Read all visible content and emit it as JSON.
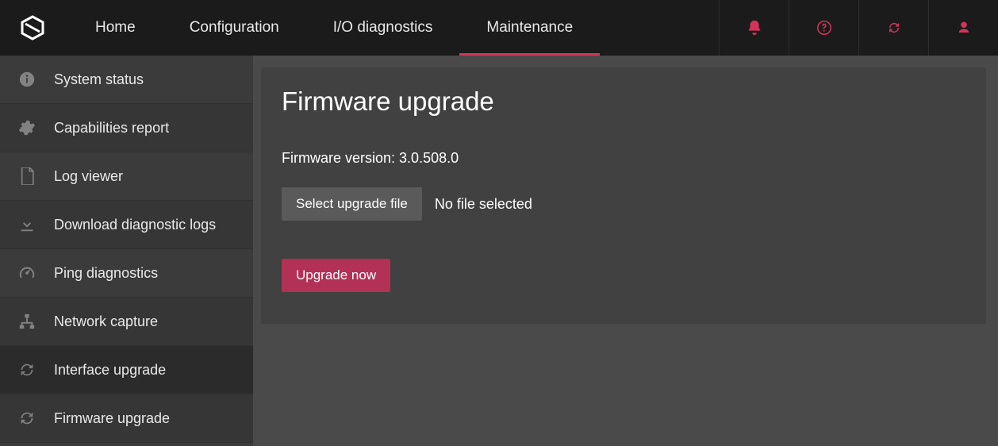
{
  "nav": {
    "items": [
      {
        "label": "Home"
      },
      {
        "label": "Configuration"
      },
      {
        "label": "I/O diagnostics"
      },
      {
        "label": "Maintenance",
        "active": true
      }
    ]
  },
  "sidebar": {
    "items": [
      {
        "label": "System status"
      },
      {
        "label": "Capabilities report"
      },
      {
        "label": "Log viewer"
      },
      {
        "label": "Download diagnostic logs"
      },
      {
        "label": "Ping diagnostics"
      },
      {
        "label": "Network capture"
      },
      {
        "label": "Interface upgrade",
        "active": true
      },
      {
        "label": "Firmware upgrade"
      }
    ]
  },
  "main": {
    "title": "Firmware upgrade",
    "fw_label": "Firmware version:",
    "fw_version": "3.0.508.0",
    "select_file_label": "Select upgrade file",
    "no_file_label": "No file selected",
    "upgrade_btn_label": "Upgrade now"
  }
}
